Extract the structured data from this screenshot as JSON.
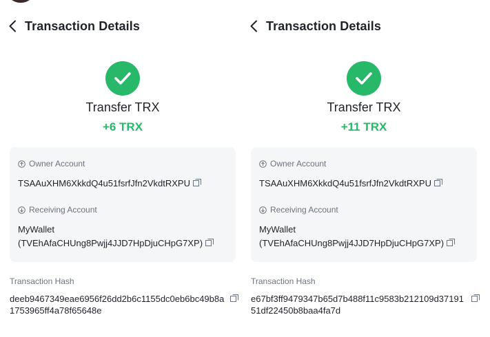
{
  "panels": [
    {
      "header": {
        "title": "Transaction Details",
        "back_icon": "chevron-left-icon"
      },
      "status_icon": "check-circle-icon",
      "tx_type": "Transfer TRX",
      "amount": "+6 TRX",
      "owner": {
        "label": "Owner Account",
        "icon": "arrow-up-circle-icon",
        "address": "TSAAuXHM6XkkdQ4u51fsrfJfn2VkdtRXPU"
      },
      "receiving": {
        "label": "Receiving Account",
        "icon": "arrow-down-circle-icon",
        "name": "MyWallet",
        "address": "(TVEhAfaCHUng8Pwjj4JJD7HpDjuCHpG7XP)"
      },
      "hash": {
        "label": "Transaction Hash",
        "value": "deeb9467349eae6956f26dd2b6c1155dc0eb6bc49b8a1753965ff4a78f65648e"
      }
    },
    {
      "header": {
        "title": "Transaction Details",
        "back_icon": "chevron-left-icon"
      },
      "status_icon": "check-circle-icon",
      "tx_type": "Transfer TRX",
      "amount": "+11 TRX",
      "owner": {
        "label": "Owner Account",
        "icon": "arrow-up-circle-icon",
        "address": "TSAAuXHM6XkkdQ4u51fsrfJfn2VkdtRXPU"
      },
      "receiving": {
        "label": "Receiving Account",
        "icon": "arrow-down-circle-icon",
        "name": "MyWallet",
        "address": "(TVEhAfaCHUng8Pwjj4JJD7HpDjuCHpG7XP)"
      },
      "hash": {
        "label": "Transaction Hash",
        "value": "e67bf3ff9479347b65d7b488f11c9583b212109d3719151df22450b8baa4fa7d"
      }
    }
  ],
  "colors": {
    "success": "#27b86a",
    "card_bg": "#f5f6f8",
    "muted_text": "#6b7280",
    "primary_text": "#1f2329"
  },
  "copy_icon": "copy-icon"
}
